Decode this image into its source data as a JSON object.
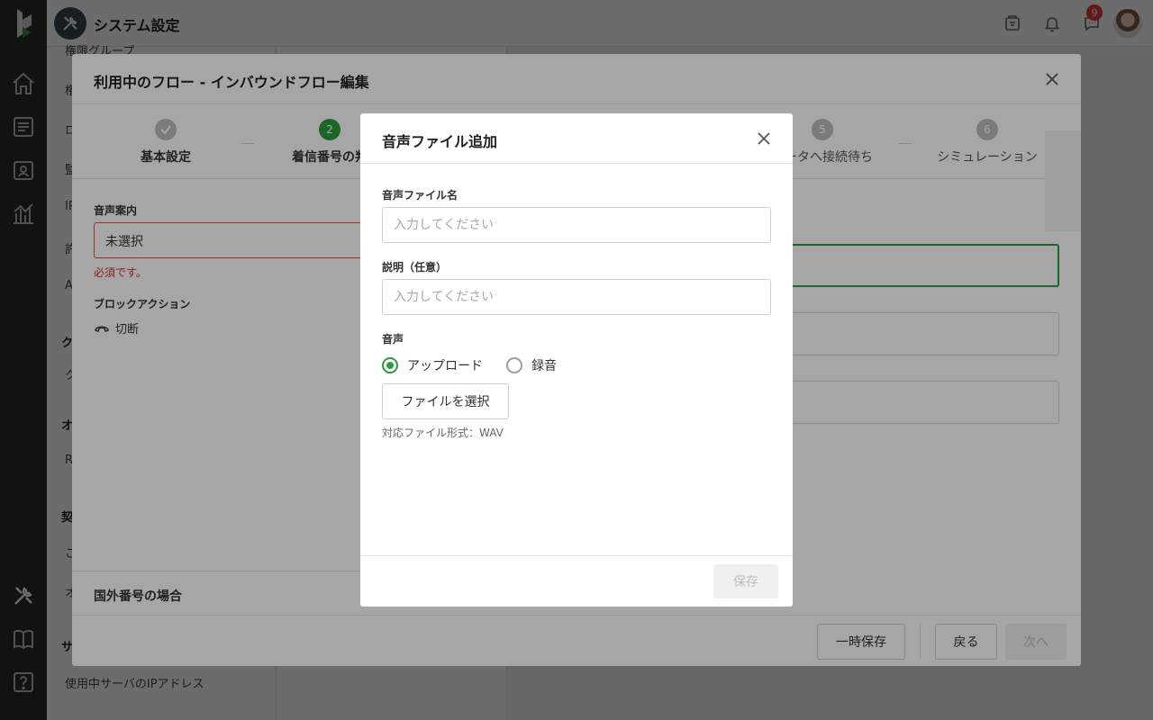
{
  "header": {
    "title": "システム設定",
    "notification_count": "9"
  },
  "background_nav": {
    "items": [
      "権限グループ",
      "権",
      "ロ",
      "監",
      "IP",
      "許",
      "A",
      "ク",
      "ク",
      "オ",
      "R",
      "契",
      "こ",
      "オ",
      "サ",
      "使用中サーバのIPアドレス"
    ]
  },
  "flow_modal": {
    "title": "利用中のフロー - インバウンドフロー編集",
    "steps": [
      {
        "number": "",
        "label": "基本設定",
        "state": "done"
      },
      {
        "number": "2",
        "label": "着信番号の判",
        "state": "active"
      },
      {
        "number": "5",
        "label": "レータへ接続待ち",
        "state": "pending"
      },
      {
        "number": "6",
        "label": "シミュレーション",
        "state": "pending"
      }
    ],
    "voice_guide_label": "音声案内",
    "voice_guide_value": "未選択",
    "required_error": "必須です。",
    "block_action_label": "ブロックアクション",
    "block_action_value": "切断",
    "foreign_number_label": "国外番号の場合",
    "buttons": {
      "temp_save": "一時保存",
      "back": "戻る",
      "next": "次へ"
    }
  },
  "dialog": {
    "title": "音声ファイル追加",
    "file_name_label": "音声ファイル名",
    "file_name_placeholder": "入力してください",
    "file_name_value": "",
    "description_label": "説明（任意）",
    "description_placeholder": "入力してください",
    "description_value": "",
    "audio_label": "音声",
    "radio_upload": "アップロード",
    "radio_record": "録音",
    "selected_option": "アップロード",
    "choose_file_button": "ファイルを選択",
    "format_hint": "対応ファイル形式：WAV",
    "save_button": "保存"
  },
  "colors": {
    "accent": "#2e9b3e",
    "error": "#d32f2f",
    "rail": "#2b2b2b"
  },
  "icons": {
    "rail": [
      "logo-icon",
      "home-icon",
      "list-icon",
      "contact-card-icon",
      "analytics-icon",
      "tools-icon",
      "book-icon",
      "help-icon"
    ],
    "header": [
      "headset-icon",
      "bell-icon",
      "chat-icon"
    ]
  }
}
